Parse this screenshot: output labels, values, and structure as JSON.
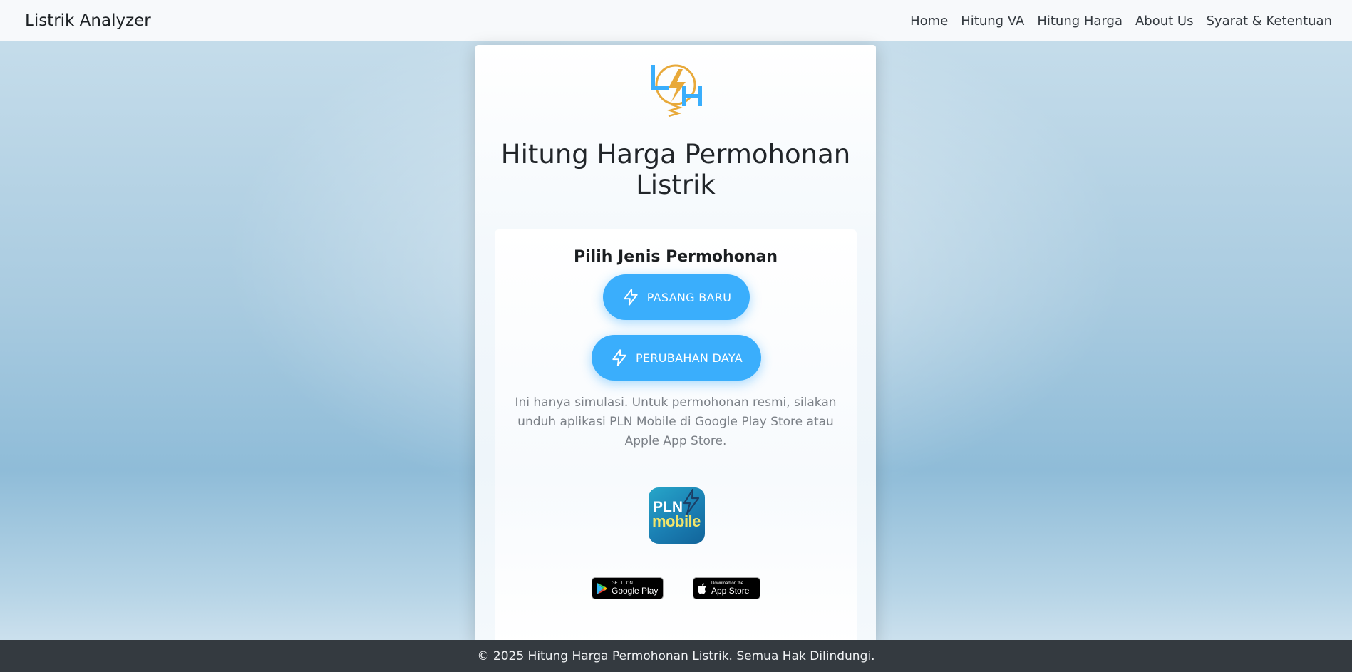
{
  "navbar": {
    "brand": "Listrik Analyzer",
    "links": [
      "Home",
      "Hitung VA",
      "Hitung Harga",
      "About Us",
      "Syarat & Ketentuan"
    ]
  },
  "card": {
    "title": "Hitung Harga Permohonan Listrik",
    "section_title": "Pilih Jenis Permohonan",
    "buttons": {
      "pasang_baru": "PASANG BARU",
      "perubahan_daya": "PERUBAHAN DAYA",
      "icon": "lightning-icon"
    },
    "note": "Ini hanya simulasi. Untuk permohonan resmi, silakan unduh aplikasi PLN Mobile di Google Play Store atau Apple App Store.",
    "pln_app": {
      "line1": "PLN",
      "line2": "mobile"
    },
    "stores": {
      "google_small": "GET IT ON",
      "google_big": "Google Play",
      "apple_small": "Download on the",
      "apple_big": "App Store"
    }
  },
  "footer": {
    "text": "© 2025 Hitung Harga Permohonan Listrik. Semua Hak Dilindungi."
  },
  "colors": {
    "accent": "#3aaefc",
    "footer_bg": "#343a40",
    "logo_orange": "#e8a93a",
    "logo_blue": "#3aaefc"
  }
}
